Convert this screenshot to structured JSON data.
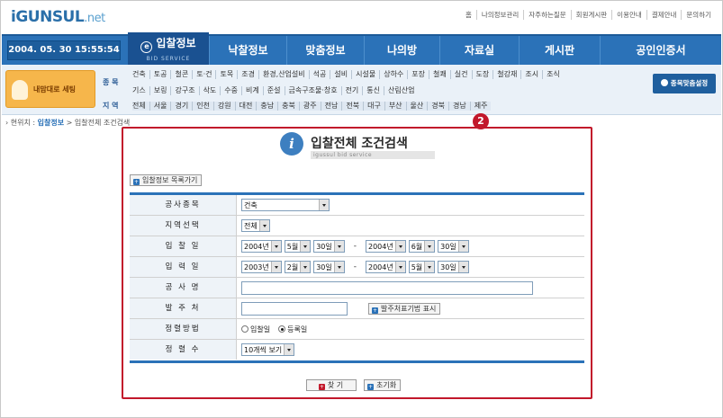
{
  "logo": {
    "main": "iGUNSUL",
    "suffix": ".net"
  },
  "top_links": [
    "홈",
    "나의정보관리",
    "자주하는질문",
    "회원게시판",
    "이용안내",
    "결제안내",
    "문의하기"
  ],
  "clock": "2004. 05. 30  15:55:54",
  "nav": {
    "active": {
      "label": "입찰정보",
      "sub": "BID SERVICE"
    },
    "tabs": [
      "낙찰정보",
      "맞춤정보",
      "나의방",
      "자료실",
      "게시판",
      "공인인증서"
    ]
  },
  "user_box": "내맘대로 세팅",
  "category_label": "종 목",
  "region_label": "지 역",
  "category_row1": [
    "건축",
    "토공",
    "철콘",
    "토·건",
    "토목",
    "조경",
    "환경,산업설비",
    "석공",
    "설비",
    "시설물",
    "상하수",
    "포장",
    "철쾌",
    "실건",
    "도장",
    "철강재",
    "조시",
    "조식"
  ],
  "category_row2": [
    "기스",
    "보링",
    "강구조",
    "삭도",
    "수중",
    "비계",
    "준설",
    "금속구조물·창호",
    "전기",
    "통신",
    "산림산업"
  ],
  "regions": [
    "전체",
    "서울",
    "경기",
    "인천",
    "강원",
    "대전",
    "충남",
    "충북",
    "광주",
    "전남",
    "전북",
    "대구",
    "부산",
    "울산",
    "경북",
    "경남",
    "제주"
  ],
  "match_button": "종목맞춤설정",
  "breadcrumb": {
    "prefix": "현위치 :",
    "section": "입찰정보",
    "sep": ">",
    "page": "입찰전체 조건검색"
  },
  "marker": "2",
  "title": {
    "main": "입찰전체 조건검색",
    "sub": "igussul bid service"
  },
  "list_button": "입찰정보 목록가기",
  "form": {
    "work_type": {
      "label": "공사종목",
      "value": "건축"
    },
    "region": {
      "label": "지역선택",
      "value": "전체"
    },
    "bid_date": {
      "label": "입 찰 일",
      "from": [
        "2004년",
        "5월",
        "30일"
      ],
      "to": [
        "2004년",
        "6월",
        "30일"
      ]
    },
    "reg_date": {
      "label": "입 력 일",
      "from": [
        "2003년",
        "2월",
        "30일"
      ],
      "to": [
        "2004년",
        "5월",
        "30일"
      ]
    },
    "project_name": {
      "label": "공 사 명",
      "value": ""
    },
    "client": {
      "label": "발 주 처",
      "value": "",
      "button": "발주처표기법 표시"
    },
    "sort_method": {
      "label": "정렬방법",
      "options": [
        "입찰일",
        "등록일"
      ],
      "selected": "등록일"
    },
    "sort_count": {
      "label": "정 렬 수",
      "value": "10개씩 보기"
    }
  },
  "search_button": "찾 기",
  "reset_button": "초기화",
  "colors": {
    "nav_blue": "#2b72b8",
    "highlight_red": "#c2182b",
    "user_orange": "#f6b64b"
  }
}
